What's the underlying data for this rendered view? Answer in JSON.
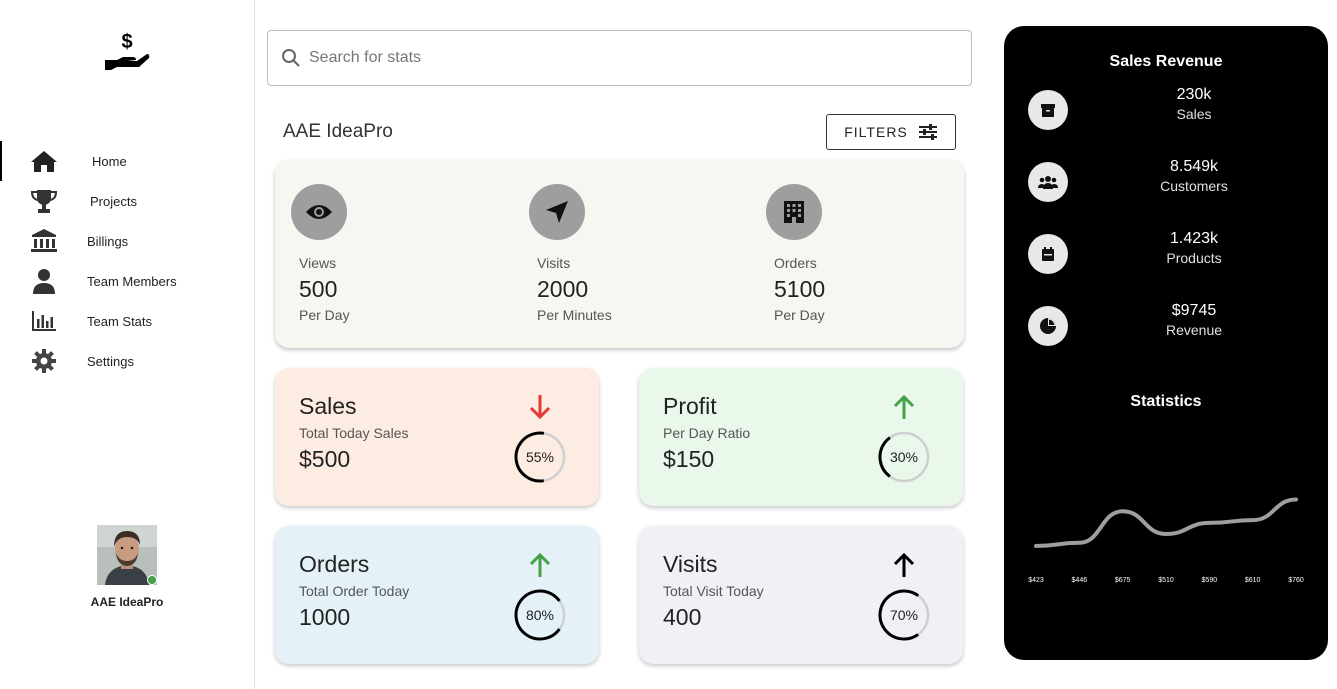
{
  "sidebar": {
    "items": [
      {
        "label": "Home",
        "icon": "home-icon",
        "active": true
      },
      {
        "label": "Projects",
        "icon": "trophy-icon"
      },
      {
        "label": "Billings",
        "icon": "bank-icon"
      },
      {
        "label": "Team Members",
        "icon": "person-icon"
      },
      {
        "label": "Team Stats",
        "icon": "bar-chart-icon"
      },
      {
        "label": "Settings",
        "icon": "gear-icon"
      }
    ],
    "profile": {
      "name": "AAE IdeaPro",
      "status": "online"
    }
  },
  "search": {
    "placeholder": "Search for stats"
  },
  "header": {
    "company": "AAE IdeaPro",
    "filters_label": "FILTERS"
  },
  "overview": [
    {
      "label": "Views",
      "value": "500",
      "unit": "Per Day",
      "icon": "eye-icon"
    },
    {
      "label": "Visits",
      "value": "2000",
      "unit": "Per Minutes",
      "icon": "navigation-arrow-icon"
    },
    {
      "label": "Orders",
      "value": "5100",
      "unit": "Per Day",
      "icon": "building-icon"
    }
  ],
  "cards": [
    {
      "title": "Sales",
      "subtitle": "Total Today Sales",
      "value": "$500",
      "percent": 55,
      "percent_label": "55%",
      "trend": "down",
      "bg": "#fdece1",
      "arrow_color": "#e53935"
    },
    {
      "title": "Profit",
      "subtitle": "Per Day Ratio",
      "value": "$150",
      "percent": 30,
      "percent_label": "30%",
      "trend": "up",
      "bg": "#eaf8ec",
      "arrow_color": "#43a047"
    },
    {
      "title": "Orders",
      "subtitle": "Total Order Today",
      "value": "1000",
      "percent": 80,
      "percent_label": "80%",
      "trend": "up",
      "bg": "#e4f2f8",
      "arrow_color": "#43a047"
    },
    {
      "title": "Visits",
      "subtitle": "Total Visit Today",
      "value": "400",
      "percent": 70,
      "percent_label": "70%",
      "trend": "up",
      "bg": "#f0f1f5",
      "arrow_color": "#000000"
    }
  ],
  "revenue": {
    "title": "Sales Revenue",
    "items": [
      {
        "value": "230k",
        "label": "Sales",
        "icon": "archive-box-icon"
      },
      {
        "value": "8.549k",
        "label": "Customers",
        "icon": "group-icon"
      },
      {
        "value": "1.423k",
        "label": "Products",
        "icon": "calendar-icon"
      },
      {
        "value": "$9745",
        "label": "Revenue",
        "icon": "pie-chart-icon"
      }
    ]
  },
  "statistics": {
    "title": "Statistics"
  },
  "chart_data": {
    "type": "line",
    "categories": [
      "$423",
      "$446",
      "$675",
      "$510",
      "$590",
      "$610",
      "$760"
    ],
    "values": [
      423,
      446,
      675,
      510,
      590,
      610,
      760
    ],
    "title": "Statistics",
    "line_color": "#9e9e9e"
  }
}
